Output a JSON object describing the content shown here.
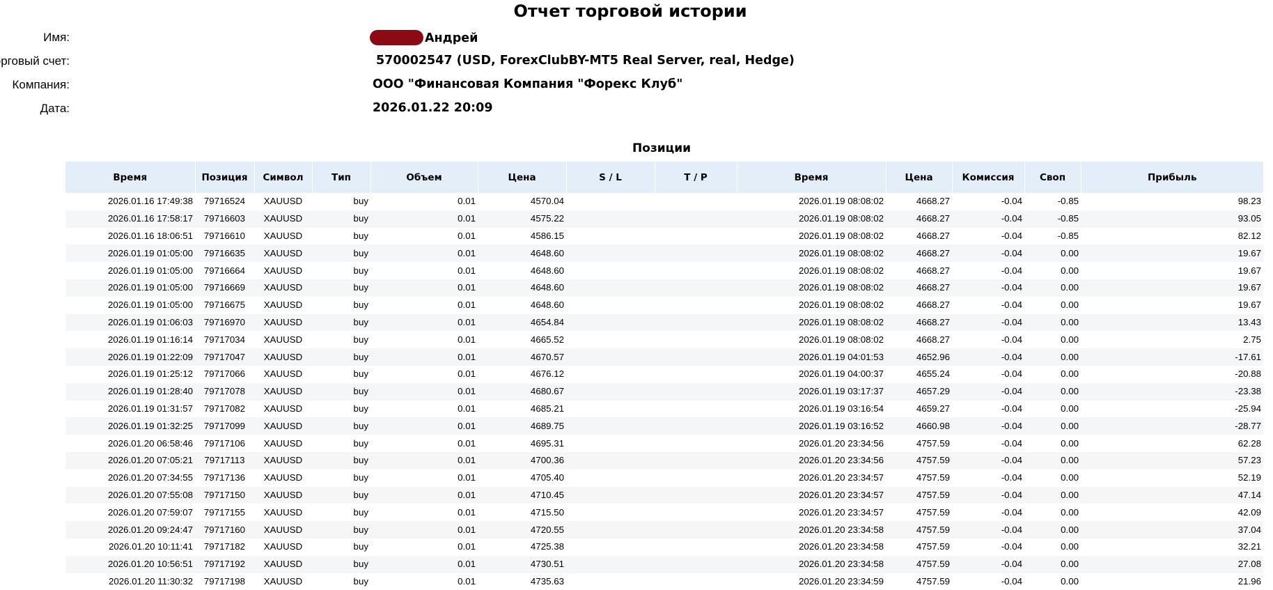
{
  "report": {
    "title": "Отчет торговой истории",
    "name_label": "Имя:",
    "name_value": "Андрей",
    "account_label": "Торговый счет:",
    "account_value": "570002547 (USD, ForexClubBY-MT5 Real Server, real, Hedge)",
    "company_label": "Компания:",
    "company_value": "ООО \"Финансовая Компания \"Форекс Клуб\"",
    "date_label": "Дата:",
    "date_value": "2026.01.22 20:09"
  },
  "positions": {
    "title": "Позиции",
    "columns": [
      "Время",
      "Позиция",
      "Символ",
      "Тип",
      "Объем",
      "Цена",
      "S / L",
      "T / P",
      "Время",
      "Цена",
      "Комиссия",
      "Своп",
      "Прибыль"
    ],
    "rows": [
      [
        "2026.01.16 17:49:38",
        "79716524",
        "XAUUSD",
        "buy",
        "0.01",
        "4570.04",
        "",
        "",
        "2026.01.19 08:08:02",
        "4668.27",
        "-0.04",
        "-0.85",
        "98.23"
      ],
      [
        "2026.01.16 17:58:17",
        "79716603",
        "XAUUSD",
        "buy",
        "0.01",
        "4575.22",
        "",
        "",
        "2026.01.19 08:08:02",
        "4668.27",
        "-0.04",
        "-0.85",
        "93.05"
      ],
      [
        "2026.01.16 18:06:51",
        "79716610",
        "XAUUSD",
        "buy",
        "0.01",
        "4586.15",
        "",
        "",
        "2026.01.19 08:08:02",
        "4668.27",
        "-0.04",
        "-0.85",
        "82.12"
      ],
      [
        "2026.01.19 01:05:00",
        "79716635",
        "XAUUSD",
        "buy",
        "0.01",
        "4648.60",
        "",
        "",
        "2026.01.19 08:08:02",
        "4668.27",
        "-0.04",
        "0.00",
        "19.67"
      ],
      [
        "2026.01.19 01:05:00",
        "79716664",
        "XAUUSD",
        "buy",
        "0.01",
        "4648.60",
        "",
        "",
        "2026.01.19 08:08:02",
        "4668.27",
        "-0.04",
        "0.00",
        "19.67"
      ],
      [
        "2026.01.19 01:05:00",
        "79716669",
        "XAUUSD",
        "buy",
        "0.01",
        "4648.60",
        "",
        "",
        "2026.01.19 08:08:02",
        "4668.27",
        "-0.04",
        "0.00",
        "19.67"
      ],
      [
        "2026.01.19 01:05:00",
        "79716675",
        "XAUUSD",
        "buy",
        "0.01",
        "4648.60",
        "",
        "",
        "2026.01.19 08:08:02",
        "4668.27",
        "-0.04",
        "0.00",
        "19.67"
      ],
      [
        "2026.01.19 01:06:03",
        "79716970",
        "XAUUSD",
        "buy",
        "0.01",
        "4654.84",
        "",
        "",
        "2026.01.19 08:08:02",
        "4668.27",
        "-0.04",
        "0.00",
        "13.43"
      ],
      [
        "2026.01.19 01:16:14",
        "79717034",
        "XAUUSD",
        "buy",
        "0.01",
        "4665.52",
        "",
        "",
        "2026.01.19 08:08:02",
        "4668.27",
        "-0.04",
        "0.00",
        "2.75"
      ],
      [
        "2026.01.19 01:22:09",
        "79717047",
        "XAUUSD",
        "buy",
        "0.01",
        "4670.57",
        "",
        "",
        "2026.01.19 04:01:53",
        "4652.96",
        "-0.04",
        "0.00",
        "-17.61"
      ],
      [
        "2026.01.19 01:25:12",
        "79717066",
        "XAUUSD",
        "buy",
        "0.01",
        "4676.12",
        "",
        "",
        "2026.01.19 04:00:37",
        "4655.24",
        "-0.04",
        "0.00",
        "-20.88"
      ],
      [
        "2026.01.19 01:28:40",
        "79717078",
        "XAUUSD",
        "buy",
        "0.01",
        "4680.67",
        "",
        "",
        "2026.01.19 03:17:37",
        "4657.29",
        "-0.04",
        "0.00",
        "-23.38"
      ],
      [
        "2026.01.19 01:31:57",
        "79717082",
        "XAUUSD",
        "buy",
        "0.01",
        "4685.21",
        "",
        "",
        "2026.01.19 03:16:54",
        "4659.27",
        "-0.04",
        "0.00",
        "-25.94"
      ],
      [
        "2026.01.19 01:32:25",
        "79717099",
        "XAUUSD",
        "buy",
        "0.01",
        "4689.75",
        "",
        "",
        "2026.01.19 03:16:52",
        "4660.98",
        "-0.04",
        "0.00",
        "-28.77"
      ],
      [
        "2026.01.20 06:58:46",
        "79717106",
        "XAUUSD",
        "buy",
        "0.01",
        "4695.31",
        "",
        "",
        "2026.01.20 23:34:56",
        "4757.59",
        "-0.04",
        "0.00",
        "62.28"
      ],
      [
        "2026.01.20 07:05:21",
        "79717113",
        "XAUUSD",
        "buy",
        "0.01",
        "4700.36",
        "",
        "",
        "2026.01.20 23:34:56",
        "4757.59",
        "-0.04",
        "0.00",
        "57.23"
      ],
      [
        "2026.01.20 07:34:55",
        "79717136",
        "XAUUSD",
        "buy",
        "0.01",
        "4705.40",
        "",
        "",
        "2026.01.20 23:34:57",
        "4757.59",
        "-0.04",
        "0.00",
        "52.19"
      ],
      [
        "2026.01.20 07:55:08",
        "79717150",
        "XAUUSD",
        "buy",
        "0.01",
        "4710.45",
        "",
        "",
        "2026.01.20 23:34:57",
        "4757.59",
        "-0.04",
        "0.00",
        "47.14"
      ],
      [
        "2026.01.20 07:59:07",
        "79717155",
        "XAUUSD",
        "buy",
        "0.01",
        "4715.50",
        "",
        "",
        "2026.01.20 23:34:57",
        "4757.59",
        "-0.04",
        "0.00",
        "42.09"
      ],
      [
        "2026.01.20 09:24:47",
        "79717160",
        "XAUUSD",
        "buy",
        "0.01",
        "4720.55",
        "",
        "",
        "2026.01.20 23:34:58",
        "4757.59",
        "-0.04",
        "0.00",
        "37.04"
      ],
      [
        "2026.01.20 10:11:41",
        "79717182",
        "XAUUSD",
        "buy",
        "0.01",
        "4725.38",
        "",
        "",
        "2026.01.20 23:34:58",
        "4757.59",
        "-0.04",
        "0.00",
        "32.21"
      ],
      [
        "2026.01.20 10:56:51",
        "79717192",
        "XAUUSD",
        "buy",
        "0.01",
        "4730.51",
        "",
        "",
        "2026.01.20 23:34:58",
        "4757.59",
        "-0.04",
        "0.00",
        "27.08"
      ],
      [
        "2026.01.20 11:30:32",
        "79717198",
        "XAUUSD",
        "buy",
        "0.01",
        "4735.63",
        "",
        "",
        "2026.01.20 23:34:59",
        "4757.59",
        "-0.04",
        "0.00",
        "21.96"
      ]
    ]
  }
}
